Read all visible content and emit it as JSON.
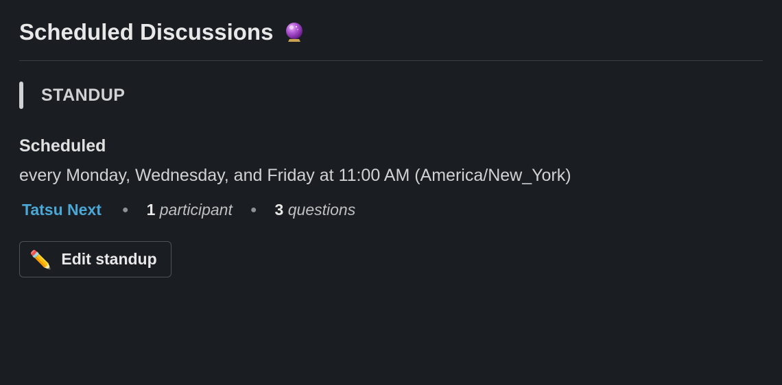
{
  "header": {
    "title": "Scheduled Discussions",
    "icon": "crystal-ball"
  },
  "standup": {
    "section_label": "STANDUP",
    "subheading": "Scheduled",
    "schedule_text": "every Monday, Wednesday, and Friday at 11:00 AM (America/New_York)",
    "link_label": "Tatsu Next",
    "participants": {
      "count": "1",
      "label": "participant"
    },
    "questions": {
      "count": "3",
      "label": "questions"
    },
    "edit_button": {
      "icon": "pencil",
      "label": "Edit standup"
    }
  }
}
